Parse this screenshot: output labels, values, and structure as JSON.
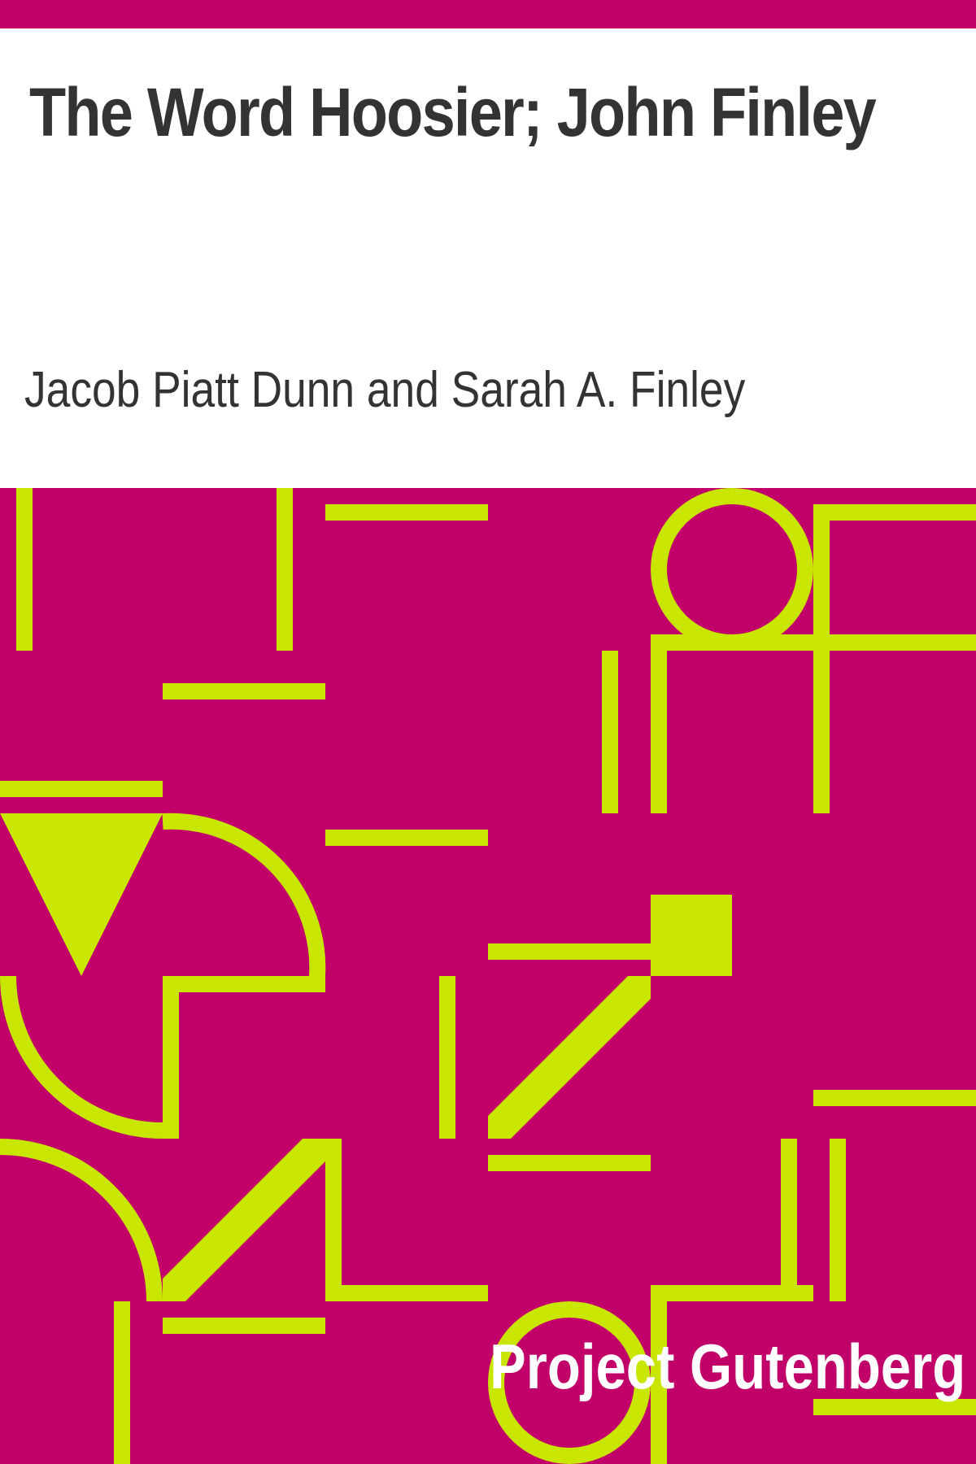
{
  "book": {
    "title": "The Word Hoosier; John Finley",
    "author": "Jacob Piatt Dunn and Sarah A. Finley",
    "publisher": "Project Gutenberg"
  },
  "colors": {
    "background": "#c2006a",
    "pattern": "#c8e600",
    "title_text": "#333333",
    "publisher_text": "#ffffff"
  }
}
